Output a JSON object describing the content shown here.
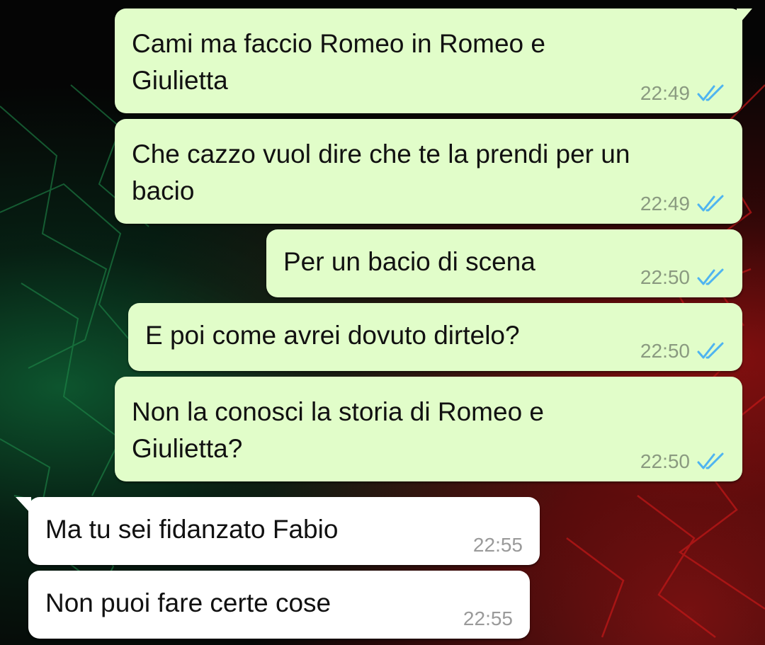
{
  "messages": [
    {
      "direction": "out",
      "text": "Cami ma faccio Romeo in Romeo e\nGiulietta",
      "time": "22:49",
      "status": "read"
    },
    {
      "direction": "out",
      "text": "Che cazzo vuol dire che te la prendi per un\nbacio",
      "time": "22:49",
      "status": "read"
    },
    {
      "direction": "out",
      "text": "Per un bacio di scena",
      "time": "22:50",
      "status": "read"
    },
    {
      "direction": "out",
      "text": "E poi come avrei dovuto dirtelo?",
      "time": "22:50",
      "status": "read"
    },
    {
      "direction": "out",
      "text": "Non la conosci la storia di Romeo e\nGiulietta?",
      "time": "22:50",
      "status": "read"
    },
    {
      "direction": "in",
      "text": "Ma tu sei fidanzato Fabio",
      "time": "22:55"
    },
    {
      "direction": "in",
      "text": "Non puoi fare certe cose",
      "time": "22:55"
    }
  ],
  "colors": {
    "outgoing_bubble": "#e1fdc9",
    "incoming_bubble": "#ffffff",
    "read_tick": "#4fb4f0"
  },
  "icons": {
    "status": "double-check-icon"
  }
}
